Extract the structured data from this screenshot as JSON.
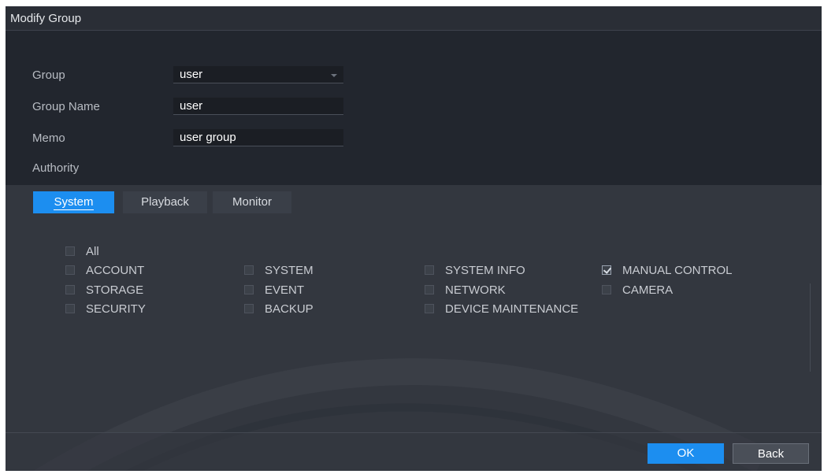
{
  "dialog": {
    "title": "Modify Group"
  },
  "form": {
    "group_label": "Group",
    "group_value": "user",
    "group_name_label": "Group Name",
    "group_name_value": "user",
    "memo_label": "Memo",
    "memo_value": "user group",
    "authority_label": "Authority"
  },
  "tabs": [
    {
      "label": "System",
      "active": true
    },
    {
      "label": "Playback",
      "active": false
    },
    {
      "label": "Monitor",
      "active": false
    }
  ],
  "permissions": {
    "all": {
      "label": "All",
      "checked": false
    },
    "items": [
      {
        "label": "ACCOUNT",
        "checked": false
      },
      {
        "label": "SYSTEM",
        "checked": false
      },
      {
        "label": "SYSTEM INFO",
        "checked": false
      },
      {
        "label": "MANUAL CONTROL",
        "checked": true
      },
      {
        "label": "STORAGE",
        "checked": false
      },
      {
        "label": "EVENT",
        "checked": false
      },
      {
        "label": "NETWORK",
        "checked": false
      },
      {
        "label": "CAMERA",
        "checked": false
      },
      {
        "label": "SECURITY",
        "checked": false
      },
      {
        "label": "BACKUP",
        "checked": false
      },
      {
        "label": "DEVICE MAINTENANCE",
        "checked": false
      }
    ]
  },
  "buttons": {
    "ok": "OK",
    "back": "Back"
  },
  "colors": {
    "accent": "#1c8ef0",
    "panel": "#22262e",
    "authority_panel": "#33373f"
  }
}
